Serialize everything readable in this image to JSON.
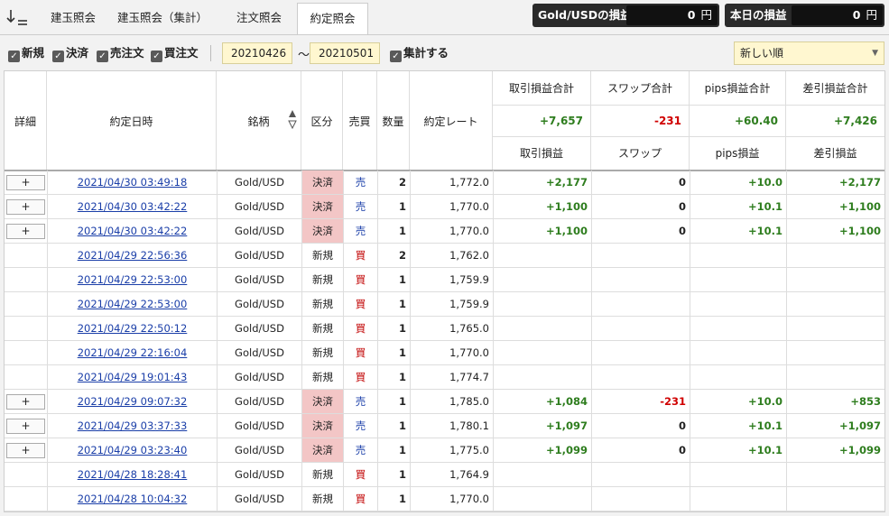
{
  "tabs": [
    "建玉照会",
    "建玉照会（集計）",
    "注文照会",
    "約定照会"
  ],
  "active_tab": "約定照会",
  "pl_boxes": [
    {
      "label": "Gold/USDの損益",
      "value": "0",
      "unit": "円"
    },
    {
      "label": "本日の損益",
      "value": "0",
      "unit": "円"
    }
  ],
  "filters": {
    "checkboxes": [
      "新規",
      "決済",
      "売注文",
      "買注文"
    ],
    "date_from": "20210426",
    "tilde": "～",
    "date_to": "20210501",
    "aggregate_label": "集計する",
    "sort_value": "新しい順"
  },
  "columns": {
    "detail": "詳細",
    "datetime": "約定日時",
    "symbol": "銘柄",
    "type": "区分",
    "side": "売買",
    "qty": "数量",
    "rate": "約定レート",
    "totals_labels": [
      "取引損益合計",
      "スワップ合計",
      "pips損益合計",
      "差引損益合計"
    ],
    "totals_values": [
      "+7,657",
      "-231",
      "+60.40",
      "+7,426"
    ],
    "sub_labels": [
      "取引損益",
      "スワップ",
      "pips損益",
      "差引損益"
    ]
  },
  "rows": [
    {
      "plus": "+",
      "dt": "2021/04/30 03:49:18",
      "sym": "Gold/USD",
      "type": "決済",
      "side": "売",
      "qty": "2",
      "rate": "1,772.0",
      "pl": "+2,177",
      "swap": "0",
      "pips": "+10.0",
      "net": "+2,177"
    },
    {
      "plus": "+",
      "dt": "2021/04/30 03:42:22",
      "sym": "Gold/USD",
      "type": "決済",
      "side": "売",
      "qty": "1",
      "rate": "1,770.0",
      "pl": "+1,100",
      "swap": "0",
      "pips": "+10.1",
      "net": "+1,100"
    },
    {
      "plus": "+",
      "dt": "2021/04/30 03:42:22",
      "sym": "Gold/USD",
      "type": "決済",
      "side": "売",
      "qty": "1",
      "rate": "1,770.0",
      "pl": "+1,100",
      "swap": "0",
      "pips": "+10.1",
      "net": "+1,100"
    },
    {
      "plus": "",
      "dt": "2021/04/29 22:56:36",
      "sym": "Gold/USD",
      "type": "新規",
      "side": "買",
      "qty": "2",
      "rate": "1,762.0",
      "pl": "",
      "swap": "",
      "pips": "",
      "net": ""
    },
    {
      "plus": "",
      "dt": "2021/04/29 22:53:00",
      "sym": "Gold/USD",
      "type": "新規",
      "side": "買",
      "qty": "1",
      "rate": "1,759.9",
      "pl": "",
      "swap": "",
      "pips": "",
      "net": ""
    },
    {
      "plus": "",
      "dt": "2021/04/29 22:53:00",
      "sym": "Gold/USD",
      "type": "新規",
      "side": "買",
      "qty": "1",
      "rate": "1,759.9",
      "pl": "",
      "swap": "",
      "pips": "",
      "net": ""
    },
    {
      "plus": "",
      "dt": "2021/04/29 22:50:12",
      "sym": "Gold/USD",
      "type": "新規",
      "side": "買",
      "qty": "1",
      "rate": "1,765.0",
      "pl": "",
      "swap": "",
      "pips": "",
      "net": ""
    },
    {
      "plus": "",
      "dt": "2021/04/29 22:16:04",
      "sym": "Gold/USD",
      "type": "新規",
      "side": "買",
      "qty": "1",
      "rate": "1,770.0",
      "pl": "",
      "swap": "",
      "pips": "",
      "net": ""
    },
    {
      "plus": "",
      "dt": "2021/04/29 19:01:43",
      "sym": "Gold/USD",
      "type": "新規",
      "side": "買",
      "qty": "1",
      "rate": "1,774.7",
      "pl": "",
      "swap": "",
      "pips": "",
      "net": ""
    },
    {
      "plus": "+",
      "dt": "2021/04/29 09:07:32",
      "sym": "Gold/USD",
      "type": "決済",
      "side": "売",
      "qty": "1",
      "rate": "1,785.0",
      "pl": "+1,084",
      "swap": "-231",
      "pips": "+10.0",
      "net": "+853"
    },
    {
      "plus": "+",
      "dt": "2021/04/29 03:37:33",
      "sym": "Gold/USD",
      "type": "決済",
      "side": "売",
      "qty": "1",
      "rate": "1,780.1",
      "pl": "+1,097",
      "swap": "0",
      "pips": "+10.1",
      "net": "+1,097"
    },
    {
      "plus": "+",
      "dt": "2021/04/29 03:23:40",
      "sym": "Gold/USD",
      "type": "決済",
      "side": "売",
      "qty": "1",
      "rate": "1,775.0",
      "pl": "+1,099",
      "swap": "0",
      "pips": "+10.1",
      "net": "+1,099"
    },
    {
      "plus": "",
      "dt": "2021/04/28 18:28:41",
      "sym": "Gold/USD",
      "type": "新規",
      "side": "買",
      "qty": "1",
      "rate": "1,764.9",
      "pl": "",
      "swap": "",
      "pips": "",
      "net": ""
    },
    {
      "plus": "",
      "dt": "2021/04/28 10:04:32",
      "sym": "Gold/USD",
      "type": "新規",
      "side": "買",
      "qty": "1",
      "rate": "1,770.0",
      "pl": "",
      "swap": "",
      "pips": "",
      "net": ""
    }
  ]
}
